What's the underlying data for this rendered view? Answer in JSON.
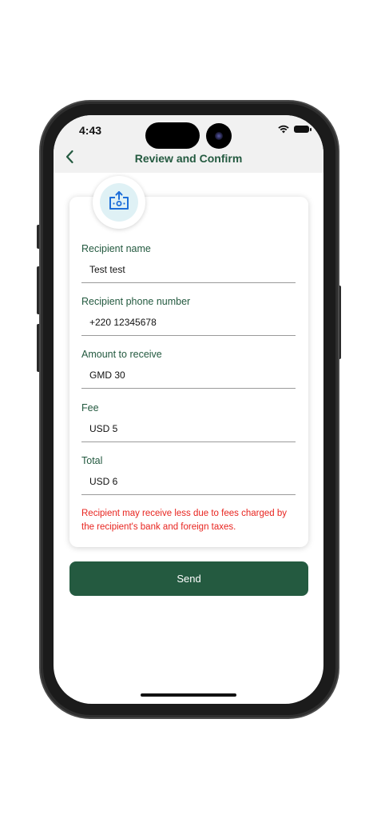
{
  "status_bar": {
    "time": "4:43"
  },
  "header": {
    "title": "Review and Confirm",
    "back_icon": "chevron-left-icon"
  },
  "hero_icon": "money-transfer-icon",
  "fields": [
    {
      "label": "Recipient name",
      "value": "Test test"
    },
    {
      "label": "Recipient phone number",
      "value": "+220 12345678"
    },
    {
      "label": "Amount to receive",
      "value": "GMD 30"
    },
    {
      "label": "Fee",
      "value": "USD 5"
    },
    {
      "label": "Total",
      "value": "USD 6"
    }
  ],
  "warning": "Recipient may receive less due to fees charged by the recipient's bank and foreign taxes.",
  "actions": {
    "send_label": "Send"
  },
  "colors": {
    "brand_green": "#245a40",
    "warning_red": "#e8241f",
    "header_bg": "#f1f1f1",
    "icon_blue": "#1e6fd9"
  }
}
